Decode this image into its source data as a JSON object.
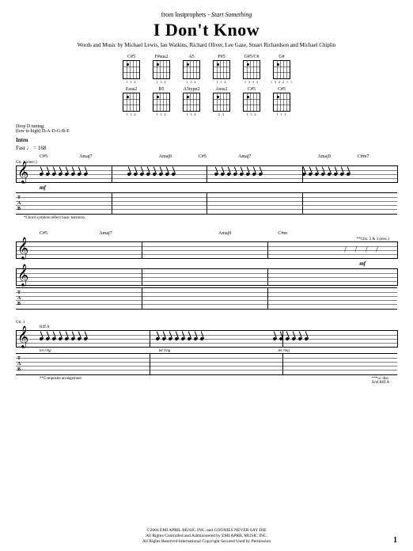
{
  "header": {
    "from_prefix": "from lostprophets",
    "separator": " - ",
    "album": "Start Something",
    "title": "I Don't Know",
    "credits": "Words and Music by Michael Lewis, Ian Watkins, Richard Oliver, Lee Gaze, Stuart Richardson and Michael Chiplin"
  },
  "chord_ref": {
    "row1": [
      {
        "name": "C#5",
        "fingering": "1 3 4"
      },
      {
        "name": "F#sus2",
        "fingering": "1 3 4"
      },
      {
        "name": "A5",
        "fingering": "1 3 4"
      },
      {
        "name": "F#5",
        "fingering": "1 3 4"
      },
      {
        "name": "G#5/C#",
        "fingering": "1 3 3 4"
      },
      {
        "name": "G#",
        "fingering": "1 3 4 2 1 1"
      }
    ],
    "row2": [
      {
        "name": "Esus2",
        "fingering": "1 3 4"
      },
      {
        "name": "B5",
        "fingering": "1 3 4"
      },
      {
        "name": "A5type2",
        "fingering": "1 3 4"
      },
      {
        "name": "Asus2",
        "fingering": "2 3"
      },
      {
        "name": "C#5",
        "fingering": "1 3 4"
      },
      {
        "name": "C#5",
        "fingering": "1 1 1"
      }
    ]
  },
  "tuning": {
    "label": "Drop D tuning:",
    "notes": "(low to high) D-A-D-G-B-E"
  },
  "intro": {
    "section": "Intro",
    "tempo_label": "Fast",
    "tempo_marking": "♩ = 168"
  },
  "system1": {
    "chords": [
      "C#5",
      "Amaj7",
      "",
      "Amaj9",
      "C#5",
      "Amaj7",
      "",
      "Amaj9",
      "C#m7"
    ],
    "part": "Gtr. 1 (elect.)",
    "dynamic": "mf",
    "tab_clef": "TAB",
    "footnote": "*Chord symbols reflect basic harmony."
  },
  "system2": {
    "chords": [
      "C#5",
      "Amaj7",
      "",
      "Amaj9",
      "C#m",
      ""
    ],
    "note1": "**Gtrs. 2 & 3 (elec.)",
    "dynamic": "mf",
    "riff_label": "Riff A"
  },
  "system3": {
    "part": "Gtr. 1",
    "let_ring": "let ring",
    "note2": "**Composite arrangement",
    "note3": "***w/ dist.",
    "end_riff": "End Riff A"
  },
  "footer": {
    "line1": "©2004 EMI APRIL MUSIC INC. and GOONIES NEVER SAY DIE",
    "line2": "All Rights Controlled and Administered by EMI APRIL MUSIC INC.",
    "line3": "All Rights Reserved   International Copyright Secured   Used by Permission"
  },
  "page_number": "1"
}
